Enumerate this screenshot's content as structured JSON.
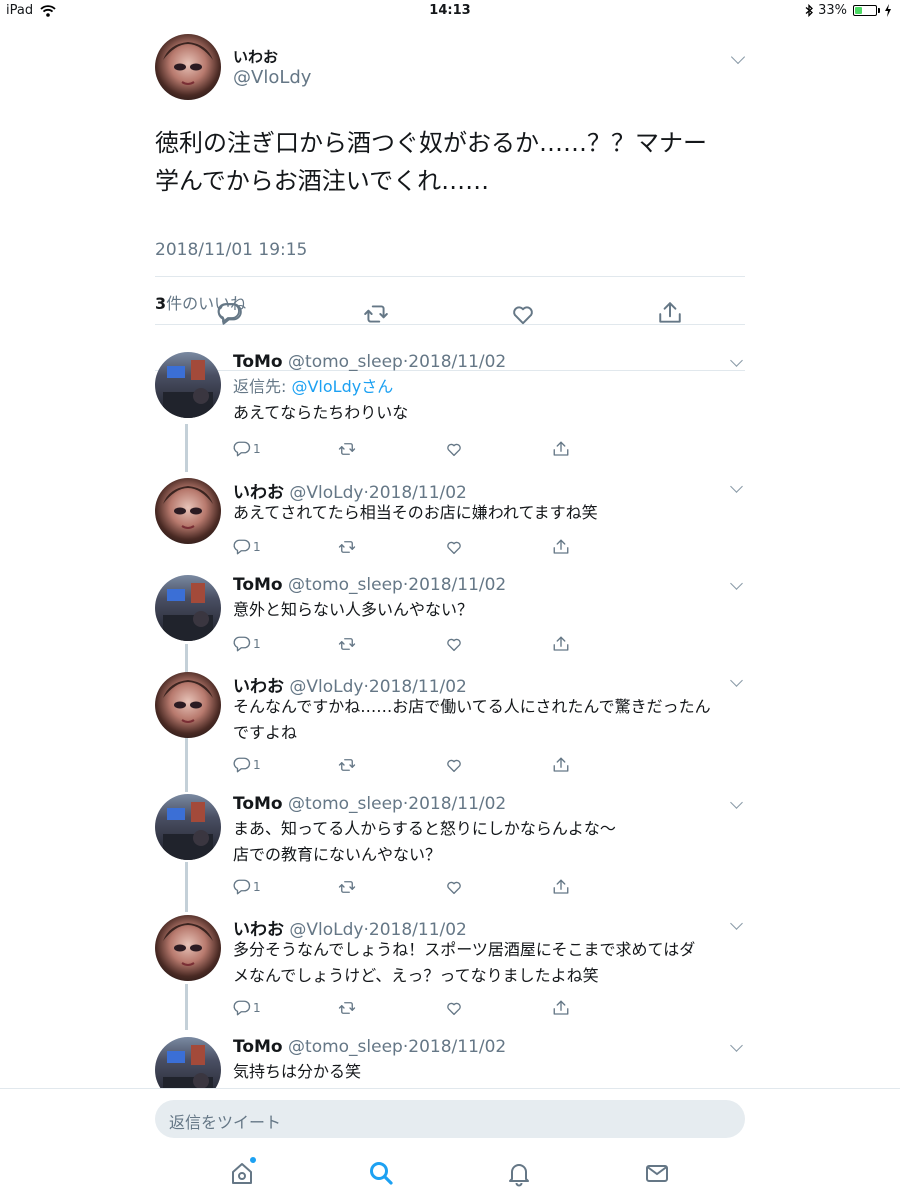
{
  "status_bar": {
    "device": "iPad",
    "time": "14:13",
    "battery": "33%",
    "battery_level": 0.33
  },
  "main_tweet": {
    "name": "いわお",
    "handle": "@VloLdy",
    "text_line1": "徳利の注ぎ口から酒つぐ奴がおるか……？？マナー",
    "text_line2": "学んでからお酒注いでくれ……",
    "datetime": "2018/11/01 19:15",
    "likes_count": "3",
    "likes_label": "件のいいね"
  },
  "replies": [
    {
      "name": "ToMo",
      "handle": "@tomo_sleep",
      "sep": "·",
      "date": "2018/11/02",
      "reply_to_label": "返信先: ",
      "reply_to_user": "@VloLdyさん",
      "lines": [
        "あえてならたちわりいな"
      ],
      "reply_count": "1"
    },
    {
      "name": "いわお",
      "handle": "@VloLdy",
      "sep": "·",
      "date": "2018/11/02",
      "lines": [
        "あえてされてたら相当そのお店に嫌われてますね笑"
      ],
      "reply_count": "1"
    },
    {
      "name": "ToMo",
      "handle": "@tomo_sleep",
      "sep": "·",
      "date": "2018/11/02",
      "lines": [
        "意外と知らない人多いんやない？"
      ],
      "reply_count": "1"
    },
    {
      "name": "いわお",
      "handle": "@VloLdy",
      "sep": "·",
      "date": "2018/11/02",
      "lines": [
        "そんなんですかね……お店で働いてる人にされたんで驚きだったん",
        "ですよね"
      ],
      "reply_count": "1"
    },
    {
      "name": "ToMo",
      "handle": "@tomo_sleep",
      "sep": "·",
      "date": "2018/11/02",
      "lines": [
        "まあ、知ってる人からすると怒りにしかならんよな〜",
        "店での教育にないんやない？"
      ],
      "reply_count": "1"
    },
    {
      "name": "いわお",
      "handle": "@VloLdy",
      "sep": "·",
      "date": "2018/11/02",
      "lines": [
        "多分そうなんでしょうね！スポーツ居酒屋にそこまで求めてはダ",
        "メなんでしょうけど、えっ？ってなりましたよね笑"
      ],
      "reply_count": "1"
    },
    {
      "name": "ToMo",
      "handle": "@tomo_sleep",
      "sep": "·",
      "date": "2018/11/02",
      "lines": [
        "気持ちは分かる笑"
      ]
    }
  ],
  "compose": {
    "placeholder": "返信をツイート"
  },
  "colors": {
    "accent": "#1da1f2",
    "secondary_text": "#657786",
    "divider": "#e1e8ed",
    "battery": "#4cd964"
  },
  "icons": [
    "wifi-icon",
    "bluetooth-icon",
    "battery-icon",
    "charging-icon",
    "chevron-down-icon",
    "reply-icon",
    "retweet-icon",
    "like-icon",
    "share-icon",
    "home-icon",
    "search-icon",
    "notifications-icon",
    "messages-icon"
  ]
}
